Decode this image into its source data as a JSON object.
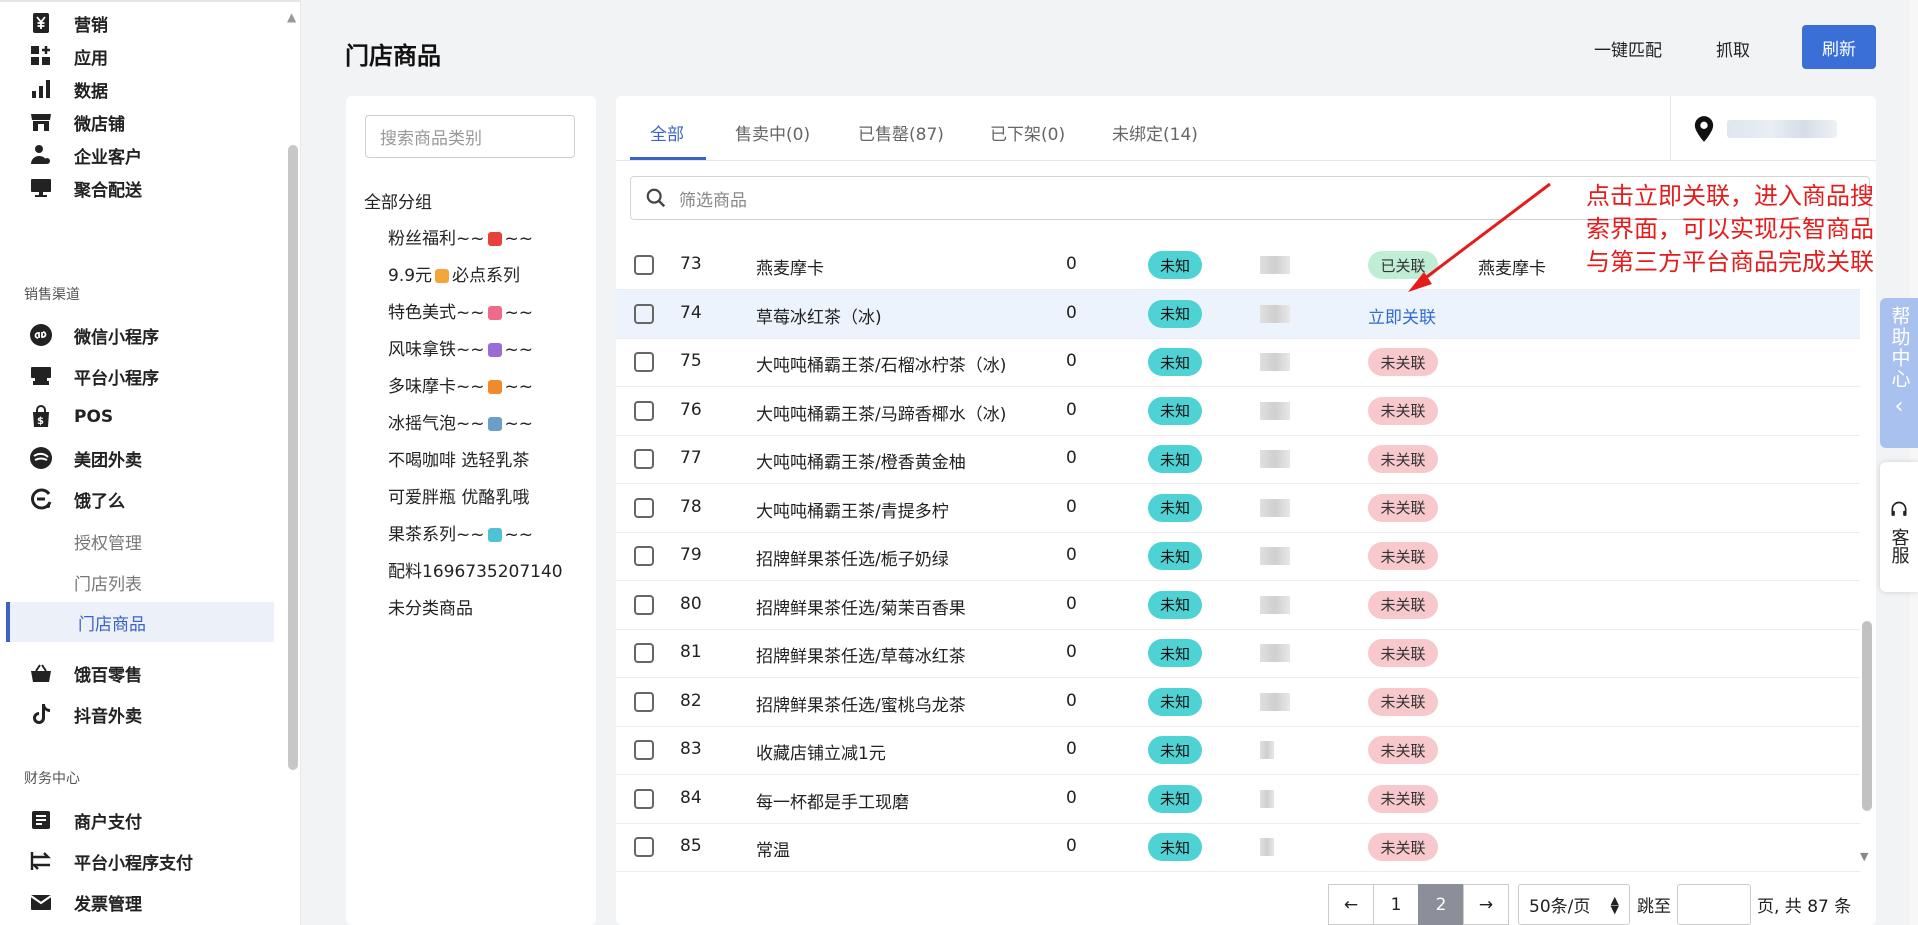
{
  "sidebar": {
    "items_top": [
      {
        "label": "营销",
        "icon": "yen-icon"
      },
      {
        "label": "应用",
        "icon": "apps-icon"
      },
      {
        "label": "数据",
        "icon": "bar-chart-icon"
      },
      {
        "label": "微店铺",
        "icon": "store-icon"
      },
      {
        "label": "企业客户",
        "icon": "user-settings-icon"
      },
      {
        "label": "聚合配送",
        "icon": "monitor-icon"
      }
    ],
    "section_sales": "销售渠道",
    "items_sales": [
      {
        "label": "微信小程序",
        "icon": "mini-program-icon"
      },
      {
        "label": "平台小程序",
        "icon": "platform-icon"
      },
      {
        "label": "POS",
        "icon": "pos-bag-icon"
      },
      {
        "label": "美团外卖",
        "icon": "meituan-icon"
      },
      {
        "label": "饿了么",
        "icon": "eleme-icon"
      }
    ],
    "sub_items": [
      "授权管理",
      "门店列表",
      "门店商品"
    ],
    "items_sales2": [
      {
        "label": "饿百零售",
        "icon": "basket-icon"
      },
      {
        "label": "抖音外卖",
        "icon": "tiktok-icon"
      }
    ],
    "section_finance": "财务中心",
    "items_finance": [
      {
        "label": "商户支付",
        "icon": "receipt-icon"
      },
      {
        "label": "平台小程序支付",
        "icon": "transfer-icon"
      },
      {
        "label": "发票管理",
        "icon": "invoice-mail-icon"
      }
    ]
  },
  "header": {
    "title": "门店商品",
    "match_all": "一键匹配",
    "fetch": "抓取",
    "refresh": "刷新"
  },
  "categories": {
    "search_placeholder": "搜索商品类别",
    "all": "全部分组",
    "items": [
      {
        "pre": "粉丝福利~~",
        "emoji_color": "#e8403a",
        "post": "~~"
      },
      {
        "pre": "9.9元",
        "emoji_color": "#f4a63a",
        "post": "必点系列"
      },
      {
        "pre": "特色美式~~",
        "emoji_color": "#f06a8a",
        "post": "~~"
      },
      {
        "pre": "风味拿铁~~",
        "emoji_color": "#9b6bd6",
        "post": "~~"
      },
      {
        "pre": "多味摩卡~~",
        "emoji_color": "#f08a2a",
        "post": "~~"
      },
      {
        "pre": "冰摇气泡~~",
        "emoji_color": "#6aa0c8",
        "post": "~~"
      },
      {
        "pre": "不喝咖啡 选轻乳茶",
        "emoji_color": "",
        "post": ""
      },
      {
        "pre": "可爱胖瓶 优酪乳哦",
        "emoji_color": "",
        "post": ""
      },
      {
        "pre": "果茶系列~~",
        "emoji_color": "#4fc2d8",
        "post": "~~"
      },
      {
        "pre": "配料1696735207140",
        "emoji_color": "",
        "post": ""
      },
      {
        "pre": "未分类商品",
        "emoji_color": "",
        "post": ""
      }
    ]
  },
  "tabs": [
    "全部",
    "售卖中(0)",
    "已售罄(87)",
    "已下架(0)",
    "未绑定(14)"
  ],
  "filter_placeholder": "筛选商品",
  "unknown_label": "未知",
  "rows": [
    {
      "no": "73",
      "name": "燕麦摩卡",
      "qty": "0",
      "status": "已关联",
      "match": "燕麦摩卡"
    },
    {
      "no": "74",
      "name": "草莓冰红茶（冰)",
      "qty": "0",
      "status": "立即关联",
      "match": ""
    },
    {
      "no": "75",
      "name": "大吨吨桶霸王茶/石榴冰柠茶（冰)",
      "qty": "0",
      "status": "未关联",
      "match": ""
    },
    {
      "no": "76",
      "name": "大吨吨桶霸王茶/马蹄香椰水（冰)",
      "qty": "0",
      "status": "未关联",
      "match": ""
    },
    {
      "no": "77",
      "name": "大吨吨桶霸王茶/橙香黄金柚",
      "qty": "0",
      "status": "未关联",
      "match": ""
    },
    {
      "no": "78",
      "name": "大吨吨桶霸王茶/青提多柠",
      "qty": "0",
      "status": "未关联",
      "match": ""
    },
    {
      "no": "79",
      "name": "招牌鲜果茶任选/栀子奶绿",
      "qty": "0",
      "status": "未关联",
      "match": ""
    },
    {
      "no": "80",
      "name": "招牌鲜果茶任选/菊茉百香果",
      "qty": "0",
      "status": "未关联",
      "match": ""
    },
    {
      "no": "81",
      "name": "招牌鲜果茶任选/草莓冰红茶",
      "qty": "0",
      "status": "未关联",
      "match": ""
    },
    {
      "no": "82",
      "name": "招牌鲜果茶任选/蜜桃乌龙茶",
      "qty": "0",
      "status": "未关联",
      "match": ""
    },
    {
      "no": "83",
      "name": "收藏店铺立减1元",
      "qty": "0",
      "status": "未关联",
      "match": ""
    },
    {
      "no": "84",
      "name": "每一杯都是手工现磨",
      "qty": "0",
      "status": "未关联",
      "match": ""
    },
    {
      "no": "85",
      "name": "常温",
      "qty": "0",
      "status": "未关联",
      "match": ""
    }
  ],
  "pagination": {
    "prev": "←",
    "pages": [
      "1",
      "2"
    ],
    "current": "2",
    "next": "→",
    "page_size": "50条/页",
    "jump_label": "跳至",
    "suffix": "页,  共 87 条"
  },
  "annotation": "点击立即关联，进入商品搜索界面，可以实现乐智商品与第三方平台商品完成关联",
  "help_center": "帮助中心",
  "help_chevron": "‹",
  "customer_service": "客服",
  "colors": {
    "accent": "#3a6fd8",
    "unknown_badge": "#4fd2d4",
    "linked_badge": "#bfeed4",
    "unlinked_badge": "#f8c9cc",
    "annotation": "#e51c1c"
  }
}
